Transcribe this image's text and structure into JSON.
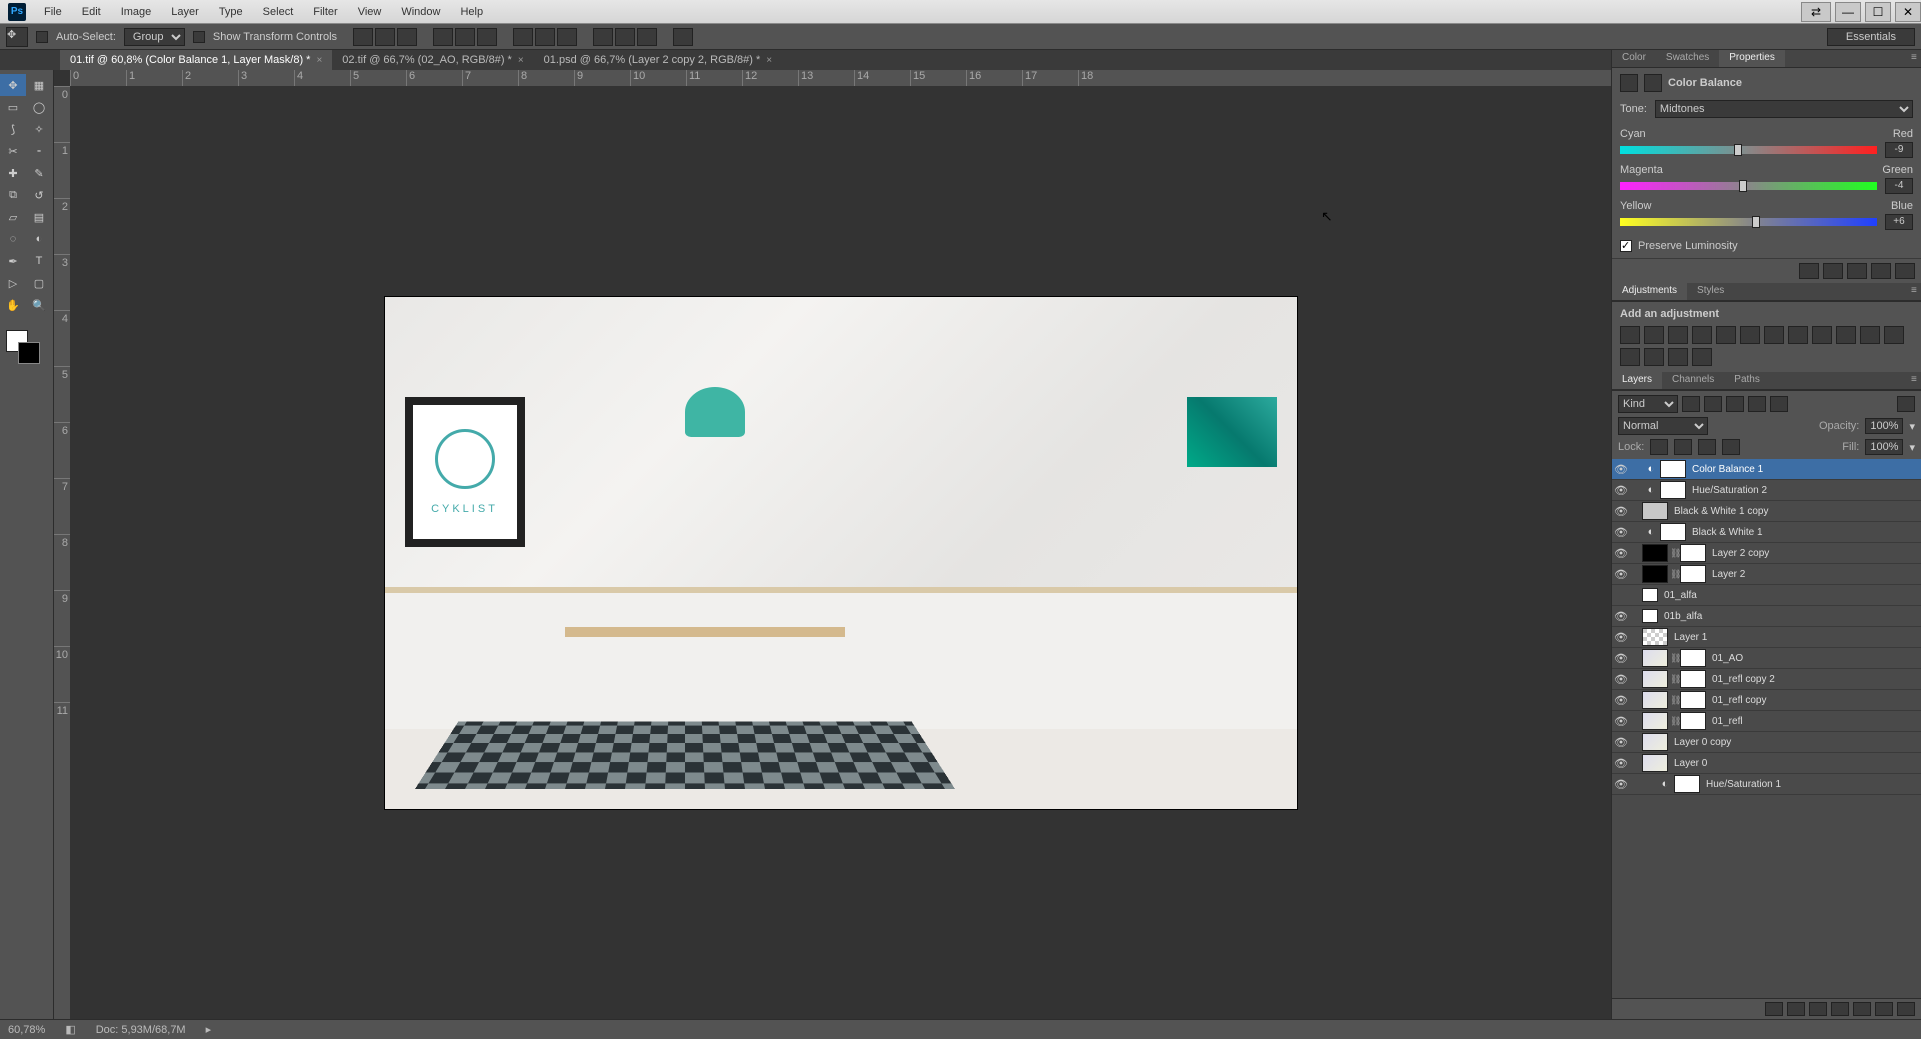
{
  "app": {
    "logo": "Ps"
  },
  "menu": [
    "File",
    "Edit",
    "Image",
    "Layer",
    "Type",
    "Select",
    "Filter",
    "View",
    "Window",
    "Help"
  ],
  "options": {
    "auto_select": "Auto-Select:",
    "auto_select_value": "Group",
    "show_transform": "Show Transform Controls"
  },
  "workspace": "Essentials",
  "tabs": [
    {
      "label": "01.tif @ 60,8% (Color Balance 1, Layer Mask/8) *",
      "active": true
    },
    {
      "label": "02.tif @ 66,7% (02_AO, RGB/8#) *",
      "active": false
    },
    {
      "label": "01.psd @ 66,7% (Layer 2 copy 2, RGB/8#) *",
      "active": false
    }
  ],
  "ruler_h": [
    "0",
    "1",
    "2",
    "3",
    "4",
    "5",
    "6",
    "7",
    "8",
    "9",
    "10",
    "11",
    "12",
    "13",
    "14",
    "15",
    "16",
    "17",
    "18"
  ],
  "ruler_v": [
    "0",
    "1",
    "2",
    "3",
    "4",
    "5",
    "6",
    "7",
    "8",
    "9",
    "10",
    "11"
  ],
  "image_poster": "CYKLIST",
  "status": {
    "zoom": "60,78%",
    "doc": "Doc: 5,93M/68,7M"
  },
  "panel_group1": [
    "Color",
    "Swatches",
    "Properties"
  ],
  "properties": {
    "title": "Color Balance",
    "tone_label": "Tone:",
    "tone_value": "Midtones",
    "sliders": [
      {
        "left": "Cyan",
        "right": "Red",
        "value": "-9",
        "pos": 46
      },
      {
        "left": "Magenta",
        "right": "Green",
        "value": "-4",
        "pos": 48
      },
      {
        "left": "Yellow",
        "right": "Blue",
        "value": "+6",
        "pos": 53
      }
    ],
    "preserve": "Preserve Luminosity"
  },
  "panel_group2": [
    "Adjustments",
    "Styles"
  ],
  "adjustments_title": "Add an adjustment",
  "panel_group3": [
    "Layers",
    "Channels",
    "Paths"
  ],
  "layers_ctrl": {
    "kind": "Kind",
    "blend": "Normal",
    "opacity_label": "Opacity:",
    "opacity": "100%",
    "lock_label": "Lock:",
    "fill_label": "Fill:",
    "fill": "100%"
  },
  "layers": [
    {
      "name": "Color Balance 1",
      "vis": true,
      "sel": true,
      "adj": true,
      "mask": "white"
    },
    {
      "name": "Hue/Saturation 2",
      "vis": true,
      "adj": true,
      "mask": "white"
    },
    {
      "name": "Black & White 1 copy",
      "vis": true,
      "simple": true
    },
    {
      "name": "Black & White 1",
      "vis": true,
      "adj": true,
      "mask": "white"
    },
    {
      "name": "Layer 2 copy",
      "vis": true,
      "thumb": "dark",
      "mask": "white",
      "link": true
    },
    {
      "name": "Layer 2",
      "vis": true,
      "thumb": "dark",
      "mask": "white",
      "link": true
    },
    {
      "name": "01_alfa",
      "vis": false,
      "thumb": "tiny"
    },
    {
      "name": "01b_alfa",
      "vis": true,
      "thumb": "tiny"
    },
    {
      "name": "Layer 1",
      "vis": true,
      "thumb": "check"
    },
    {
      "name": "01_AO",
      "vis": true,
      "thumb": "img",
      "mask": "white",
      "link": true
    },
    {
      "name": "01_refl copy 2",
      "vis": true,
      "thumb": "img",
      "mask": "white",
      "link": true
    },
    {
      "name": "01_refl copy",
      "vis": true,
      "thumb": "img",
      "mask": "white",
      "link": true
    },
    {
      "name": "01_refl",
      "vis": true,
      "thumb": "img",
      "mask": "white",
      "link": true
    },
    {
      "name": "Layer 0 copy",
      "vis": true,
      "thumb": "img"
    },
    {
      "name": "Layer 0",
      "vis": true,
      "thumb": "img"
    },
    {
      "name": "Hue/Saturation 1",
      "vis": true,
      "adj": true,
      "mask": "white",
      "indent": true
    }
  ],
  "tools": [
    [
      "move",
      "artboard"
    ],
    [
      "marquee-rect",
      "marquee-ellipse"
    ],
    [
      "lasso",
      "magic-wand"
    ],
    [
      "crop",
      "eyedropper"
    ],
    [
      "spot-heal",
      "brush"
    ],
    [
      "clone",
      "history-brush"
    ],
    [
      "eraser",
      "gradient"
    ],
    [
      "blur",
      "dodge"
    ],
    [
      "pen",
      "type"
    ],
    [
      "path-sel",
      "rectangle"
    ],
    [
      "hand",
      "zoom"
    ]
  ],
  "tool_glyphs": {
    "move": "✥",
    "artboard": "▦",
    "marquee-rect": "▭",
    "marquee-ellipse": "◯",
    "lasso": "⟆",
    "magic-wand": "✧",
    "crop": "✂",
    "eyedropper": "⁃",
    "spot-heal": "✚",
    "brush": "✎",
    "clone": "⧉",
    "history-brush": "↺",
    "eraser": "▱",
    "gradient": "▤",
    "blur": "◌",
    "dodge": "◐",
    "pen": "✒",
    "type": "T",
    "path-sel": "▷",
    "rectangle": "▢",
    "hand": "✋",
    "zoom": "🔍"
  }
}
